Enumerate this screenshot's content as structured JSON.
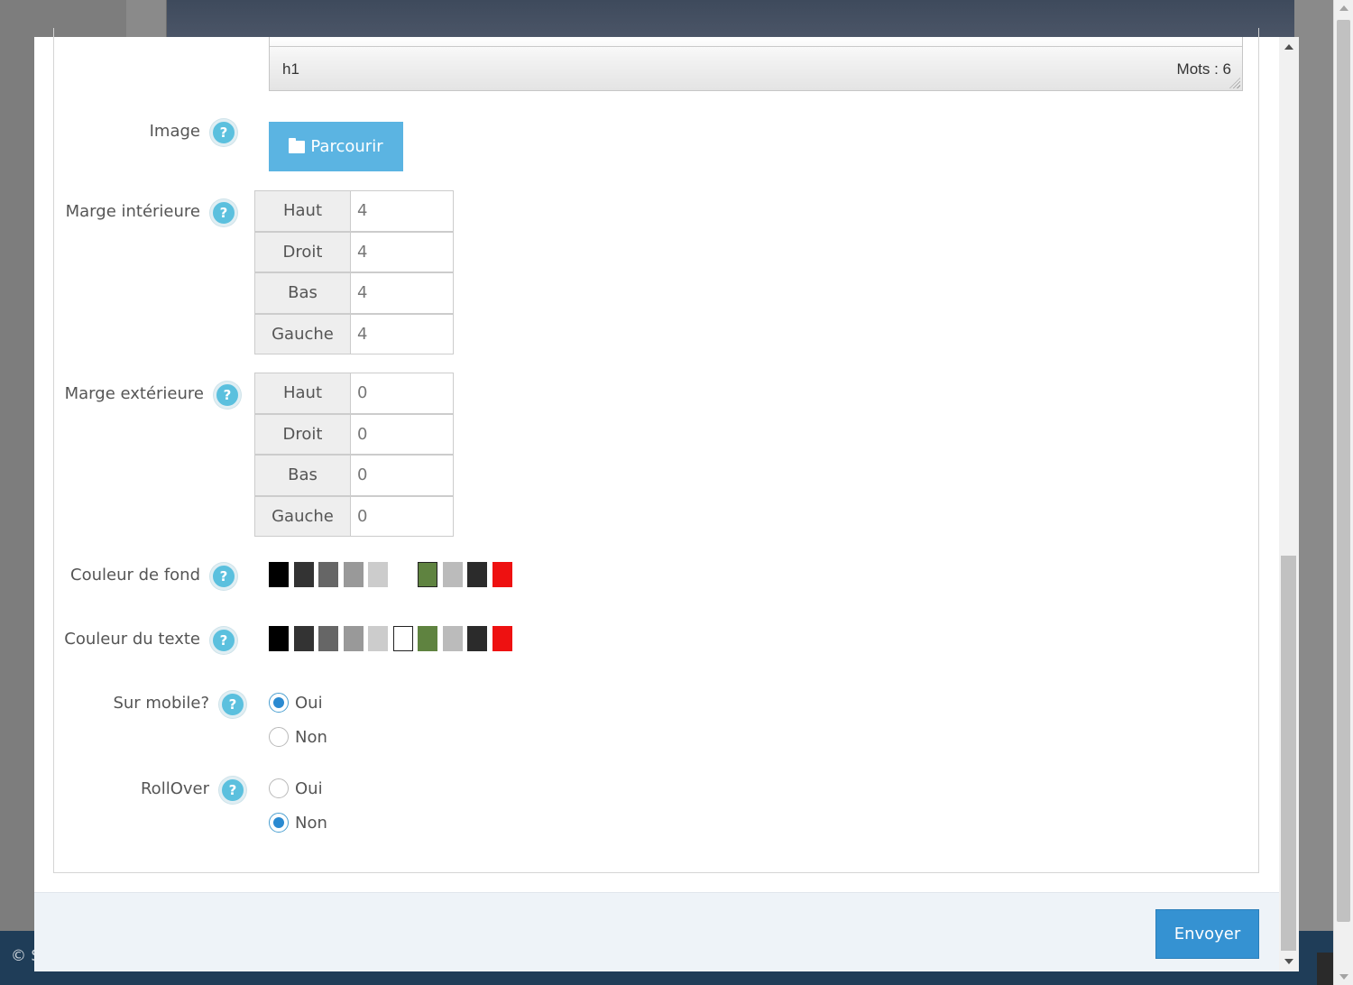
{
  "background": {
    "footer_text": "© S"
  },
  "editor": {
    "path": "h1",
    "word_count": "Mots : 6"
  },
  "form": {
    "image": {
      "label": "Image",
      "browse_label": "Parcourir",
      "help": "?"
    },
    "inner_margin": {
      "label": "Marge intérieure",
      "help": "?",
      "rows": [
        {
          "side": "Haut",
          "value": "4"
        },
        {
          "side": "Droit",
          "value": "4"
        },
        {
          "side": "Bas",
          "value": "4"
        },
        {
          "side": "Gauche",
          "value": "4"
        }
      ]
    },
    "outer_margin": {
      "label": "Marge extérieure",
      "help": "?",
      "rows": [
        {
          "side": "Haut",
          "value": "0"
        },
        {
          "side": "Droit",
          "value": "0"
        },
        {
          "side": "Bas",
          "value": "0"
        },
        {
          "side": "Gauche",
          "value": "0"
        }
      ]
    },
    "background_color": {
      "label": "Couleur de fond",
      "help": "?",
      "swatches": [
        "#000000",
        "#333333",
        "#666666",
        "#999999",
        "#cccccc",
        "#ffffff",
        "#5f8340",
        "#bbbbbb",
        "#2b2b2b",
        "#ee1111"
      ],
      "selected": "#5f8340"
    },
    "text_color": {
      "label": "Couleur du texte",
      "help": "?",
      "swatches": [
        "#000000",
        "#333333",
        "#666666",
        "#999999",
        "#cccccc",
        "#ffffff",
        "#5f8340",
        "#bbbbbb",
        "#2b2b2b",
        "#ee1111"
      ],
      "selected": "#ffffff"
    },
    "mobile": {
      "label": "Sur mobile?",
      "help": "?",
      "options": [
        "Oui",
        "Non"
      ],
      "selected": "Oui"
    },
    "rollover": {
      "label": "RollOver",
      "help": "?",
      "options": [
        "Oui",
        "Non"
      ],
      "selected": "Non"
    }
  },
  "footer": {
    "submit_label": "Envoyer"
  }
}
